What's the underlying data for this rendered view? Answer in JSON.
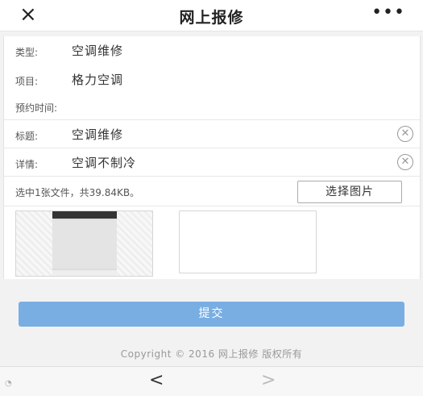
{
  "header": {
    "close_icon": "×",
    "title": "网上报修",
    "more_icon": "•••"
  },
  "form": {
    "type_label": "类型:",
    "type_value": "空调维修",
    "item_label": "项目:",
    "item_value": "格力空调",
    "time_label": "预约时间:",
    "subject_label": "标题:",
    "subject_value": "空调维修",
    "detail_label": "详情:",
    "detail_value": "空调不制冷"
  },
  "upload": {
    "info": "选中1张文件，共39.84KB。",
    "choose_button": "选择图片"
  },
  "actions": {
    "submit": "提交"
  },
  "footer": {
    "copyright": "Copyright © 2016 网上报修 版权所有"
  },
  "bottom_nav": {
    "back": "<",
    "forward": ">"
  }
}
